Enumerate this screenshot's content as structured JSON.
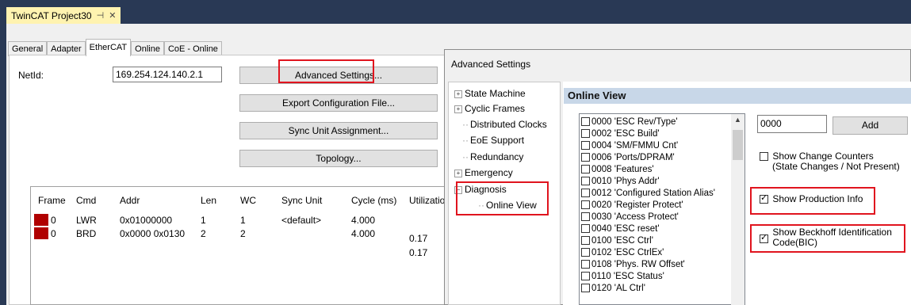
{
  "document_tab": {
    "title": "TwinCAT Project30",
    "pin": "⊣",
    "close": "✕"
  },
  "tabs": [
    {
      "label": "General",
      "active": false
    },
    {
      "label": "Adapter",
      "active": false
    },
    {
      "label": "EtherCAT",
      "active": true
    },
    {
      "label": "Online",
      "active": false
    },
    {
      "label": "CoE - Online",
      "active": false
    }
  ],
  "ethercat": {
    "netid_label": "NetId:",
    "netid_value": "169.254.124.140.2.1",
    "buttons": {
      "advanced": "Advanced Settings...",
      "export": "Export Configuration File...",
      "sync": "Sync Unit Assignment...",
      "topology": "Topology..."
    }
  },
  "frame_table": {
    "columns": [
      "Frame",
      "Cmd",
      "Addr",
      "Len",
      "WC",
      "Sync Unit",
      "Cycle (ms)",
      "Utilizatio"
    ],
    "rows": [
      {
        "frame": "0",
        "cmd": "LWR",
        "addr": "0x01000000",
        "len": "1",
        "wc": "1",
        "sync": "<default>",
        "cycle": "4.000",
        "util": ""
      },
      {
        "frame": "0",
        "cmd": "BRD",
        "addr": "0x0000 0x0130",
        "len": "2",
        "wc": "2",
        "sync": "",
        "cycle": "4.000",
        "util": "0.17"
      },
      {
        "frame": "",
        "cmd": "",
        "addr": "",
        "len": "",
        "wc": "",
        "sync": "",
        "cycle": "",
        "util": "0.17"
      }
    ],
    "frame_color": "#b00000"
  },
  "dialog": {
    "title": "Advanced Settings",
    "tree": [
      {
        "label": "State Machine",
        "expander": "+"
      },
      {
        "label": "Cyclic Frames",
        "expander": "+"
      },
      {
        "label": "Distributed Clocks",
        "expander": ""
      },
      {
        "label": "EoE Support",
        "expander": ""
      },
      {
        "label": "Redundancy",
        "expander": ""
      },
      {
        "label": "Emergency",
        "expander": "+"
      },
      {
        "label": "Diagnosis",
        "expander": "−"
      },
      {
        "label": "Online View",
        "expander": ""
      }
    ],
    "content_title": "Online View",
    "registers": [
      "0000 'ESC Rev/Type'",
      "0002 'ESC Build'",
      "0004 'SM/FMMU Cnt'",
      "0006 'Ports/DPRAM'",
      "0008 'Features'",
      "0010 'Phys Addr'",
      "0012 'Configured Station Alias'",
      "0020 'Register Protect'",
      "0030 'Access Protect'",
      "0040 'ESC reset'",
      "0100 'ESC Ctrl'",
      "0102 'ESC CtrlEx'",
      "0108 'Phys. RW Offset'",
      "0110 'ESC Status'",
      "0120 'AL Ctrl'"
    ],
    "register_input": "0000",
    "add_label": "Add",
    "options": {
      "counters_line1": "Show Change Counters",
      "counters_line2": "(State Changes / Not Present)",
      "counters_checked": false,
      "production": "Show Production Info",
      "production_checked": true,
      "bic_line1": "Show Beckhoff Identification",
      "bic_line2": "Code(BIC)",
      "bic_checked": true
    }
  },
  "highlight_color": "#e0141e"
}
